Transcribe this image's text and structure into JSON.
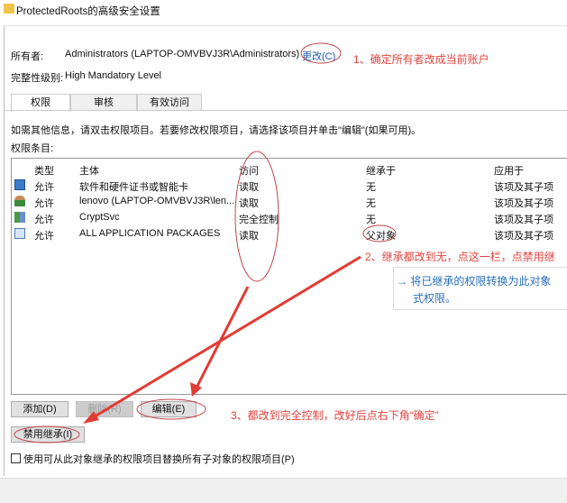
{
  "window": {
    "title": "ProtectedRoots的高级安全设置"
  },
  "owner": {
    "label": "所有者:",
    "value": "Administrators (LAPTOP-OMVBVJ3R\\Administrators)",
    "change_link": "更改(C)"
  },
  "integrity": {
    "label": "完整性级别:",
    "value": "High Mandatory Level"
  },
  "tabs": [
    {
      "label": "权限"
    },
    {
      "label": "审核"
    },
    {
      "label": "有效访问"
    }
  ],
  "info_text": "如需其他信息，请双击权限项目。若要修改权限项目，请选择该项目并单击\"编辑\"(如果可用)。",
  "entries_label": "权限条目:",
  "columns": [
    "类型",
    "主体",
    "访问",
    "继承于",
    "应用于"
  ],
  "rows": [
    {
      "icon": "certificate-group-icon",
      "type": "允许",
      "principal": "软件和硬件证书或智能卡",
      "access": "读取",
      "inherited": "无",
      "applies": "该项及其子项"
    },
    {
      "icon": "user-icon",
      "type": "允许",
      "principal": "lenovo (LAPTOP-OMVBVJ3R\\len...",
      "access": "读取",
      "inherited": "无",
      "applies": "该项及其子项"
    },
    {
      "icon": "group-icon",
      "type": "允许",
      "principal": "CryptSvc",
      "access": "完全控制",
      "inherited": "无",
      "applies": "该项及其子项"
    },
    {
      "icon": "package-icon",
      "type": "允许",
      "principal": "ALL APPLICATION PACKAGES",
      "access": "读取",
      "inherited": "父对象",
      "applies": "该项及其子项"
    }
  ],
  "buttons": {
    "add": "添加(D)",
    "remove": "删除(R)",
    "edit": "编辑(E)",
    "disable_inheritance": "禁用继承(I)"
  },
  "checkbox": {
    "label": "使用可从此对象继承的权限项目替换所有子对象的权限项目(P)",
    "checked": false
  },
  "annotations": {
    "step1": "1、确定所有者改成当前账户",
    "step2": "2、继承都改到无，点这一栏，点禁用继",
    "step2_hint": "→ 将已继承的权限转换为此对象",
    "step2_hint2": "式权限。",
    "step3": "3、都改到完全控制，改好后点右下角“确定”"
  },
  "colors": {
    "annotation": "#e0443f",
    "hint": "#2a6fb8"
  }
}
